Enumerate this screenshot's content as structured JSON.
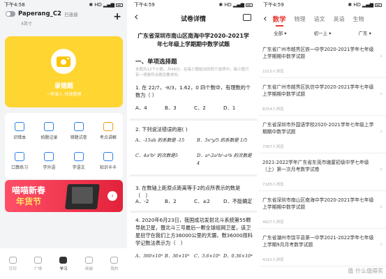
{
  "status_bar": {
    "s1_time": "下午4:58",
    "s2_time": "下午4:59",
    "s3_time": "下午4:59",
    "s1_net": "HD",
    "s2_net": "HD",
    "s3_net": "HD"
  },
  "home": {
    "device_name": "Paperang_C2",
    "device_status": "已连接",
    "device_sub": "4英寸",
    "hero_title": "录错题",
    "hero_sub": "一秒录入 快速整理",
    "tools": [
      {
        "label": "识错本",
        "icon": "notebook-icon"
      },
      {
        "label": "拍题记录",
        "icon": "camera-icon"
      },
      {
        "label": "错题试卷",
        "icon": "paper-icon"
      },
      {
        "label": "考点讲解",
        "icon": "video-icon"
      },
      {
        "label": "口算练习",
        "icon": "calc-icon"
      },
      {
        "label": "学外语",
        "icon": "translate-icon"
      },
      {
        "label": "学语文",
        "icon": "book-icon"
      },
      {
        "label": "知识卡卡",
        "icon": "card-icon"
      }
    ],
    "banner_line1": "喵喵新春",
    "banner_line2": "年货节",
    "banner_go": "›",
    "tabbar": [
      {
        "label": "打印",
        "active": false
      },
      {
        "label": "广场",
        "active": false
      },
      {
        "label": "学习",
        "active": true
      },
      {
        "label": "商城",
        "active": false
      },
      {
        "label": "我的",
        "active": false
      }
    ]
  },
  "paper": {
    "header_title": "试卷详情",
    "doc_title": "广东省深圳市南山区南海中学2020-2021学年七年级上学期期中数学试题",
    "section": "一、单项选择题",
    "note": "本题共12个小题，共48分，在每小题给出的四个选项中，每小题只有一项是符合题目要求的。",
    "q1_text": "1. 在 22/7，-π/3，1.62，0 四个数中，有理数的个数为（ ）",
    "q1_opts": [
      "A．4",
      "B．3",
      "C．2",
      "D．1"
    ],
    "q2_text": "2. 下列说法错误的是(  )",
    "q2_a": "A．-15ab 的系数是 -15",
    "q2_b": "B．3x²y/5 的系数是 1/5",
    "q2_c": "C．4a³b² 的次数是5",
    "q2_d": "D．a⁴-2a³b²-a³b 的次数是4",
    "q3_text": "3. 在数轴上距原点距离等于2的点所表示的数是（　）",
    "q3_opts": [
      "A．-2",
      "B．2",
      "C．±2",
      "D．不能确定"
    ],
    "q4_text": "4. 2020年6月23日，我国成功发射北斗系统第55颗导航卫星，暨北斗三号最后一颗全球组网卫星，该卫星驻守在我们上方36000公里的天疆，数36000用科学记数法表示为（　）",
    "q4_opts": [
      "A．360×10²",
      "B．36×10³",
      "C．3.6×10⁵",
      "D．0.36×10⁴"
    ]
  },
  "list": {
    "tabs": [
      "数学",
      "物理",
      "语文",
      "英语",
      "生物"
    ],
    "active_tab": "数学",
    "filters": [
      "全部 ▾",
      "初一上 ▾",
      "广东 ▾"
    ],
    "items": [
      {
        "title": "广东省广州市越秀区铁一中学2020-2021学年七年级上学期期中数学试题",
        "meta": "1015人浏览"
      },
      {
        "title": "广东省广州市越秀区执信中学2020-2021学年七年级上学期期中数学试题",
        "meta": "8254人浏览"
      },
      {
        "title": "广东省深圳市外国语学校2020-2021学年七年级上学期期中数学试题",
        "meta": "7067人浏览"
      },
      {
        "title": "2021-2022学年广东省东莞市塘厦初级中学七年级（上）第一次月考数学试卷",
        "meta": "7185人浏览"
      },
      {
        "title": "广东省深圳市南山区南海中学2020-2021学年七年级上学期期中数学试题",
        "meta": "4927人浏览"
      },
      {
        "title": "广东省潮州市饶平县第一中学2021-2022学年七年级上学期9月月考数学试题",
        "meta": "4161人浏览"
      }
    ],
    "watermark": "值 什么值得买"
  }
}
